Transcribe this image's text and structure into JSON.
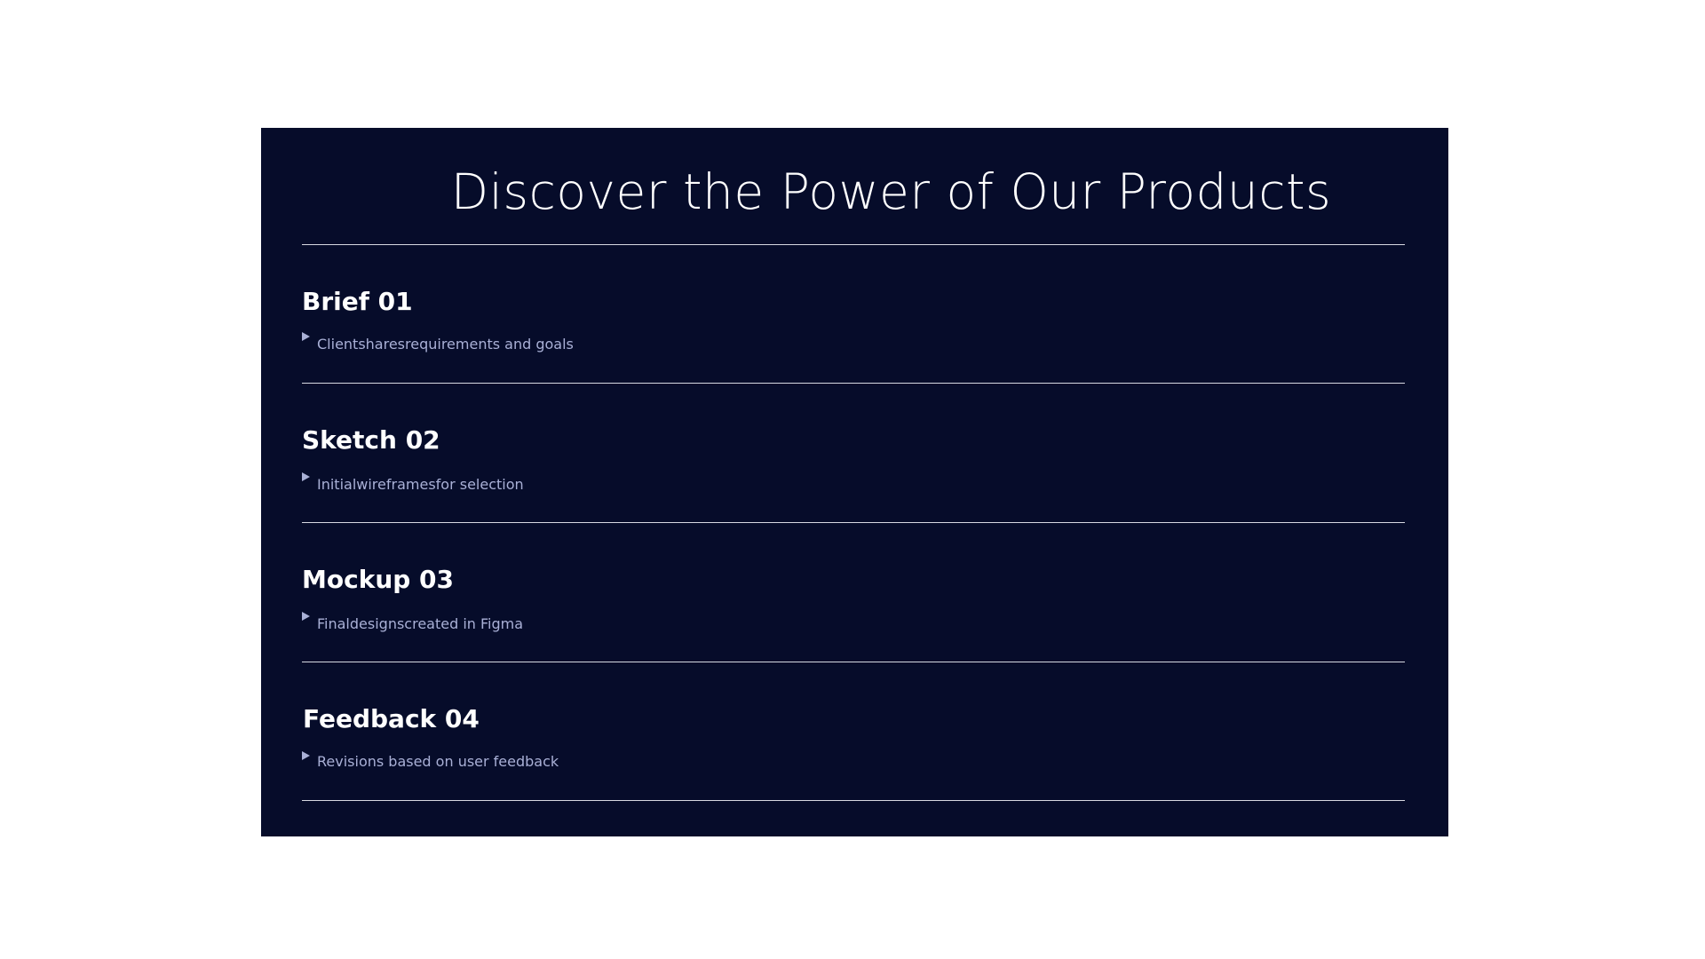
{
  "page": {
    "title": "Discover the Power of Our Products"
  },
  "colors": {
    "page_background": "#ffffff",
    "panel_background": "#060c2a",
    "title_text": "#ffffff",
    "description_text": "#a9b0d6",
    "divider": "#d7d9e2"
  },
  "icons": {
    "bullet": "play-triangle-icon"
  },
  "items": [
    {
      "title": "Brief 01",
      "description": "Clientsharesrequirements and goals"
    },
    {
      "title": "Sketch 02",
      "description": "Initialwireframesfor selection"
    },
    {
      "title": "Mockup 03",
      "description": "Finaldesignscreated in Figma"
    },
    {
      "title": "Feedback 04",
      "description": "Revisions based on user feedback"
    }
  ]
}
